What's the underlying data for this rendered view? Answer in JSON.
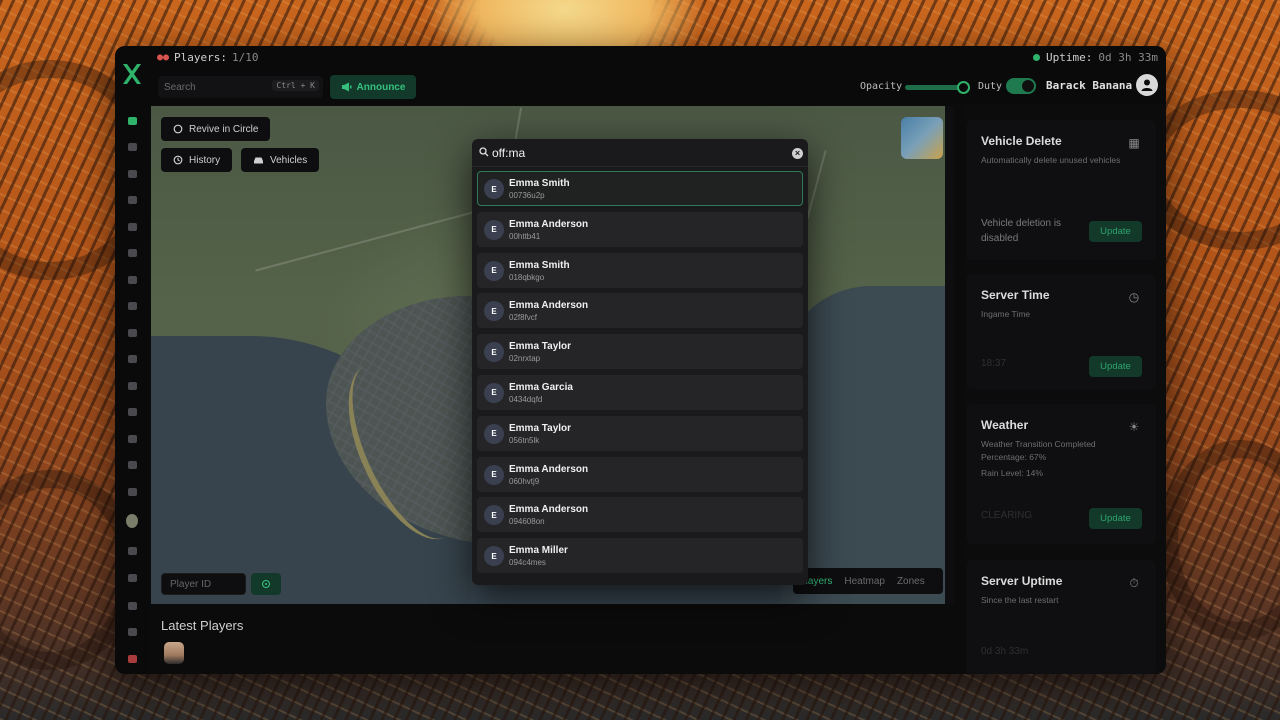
{
  "header": {
    "players_label": "Players:",
    "players_count": "1/10",
    "uptime_label": "Uptime:",
    "uptime_value": "0d 3h 33m",
    "search_placeholder": "Search",
    "search_shortcut": "Ctrl + K",
    "announce_label": "Announce",
    "opacity_label": "Opacity",
    "opacity_value": 0.95,
    "duty_label": "Duty",
    "duty_on": true,
    "username": "Barack Banana"
  },
  "sidebar": {
    "items": [
      "home-icon",
      "players-icon",
      "chat-icon",
      "grid-icon",
      "message-icon",
      "bug-icon",
      "car-icon",
      "inventory-icon",
      "calendar-icon",
      "shield-icon",
      "shield-alert-icon",
      "box-icon",
      "activity-icon",
      "server-icon",
      "clock-icon",
      "avatar",
      "layers-icon",
      "moon-icon",
      "help-icon",
      "settings-icon",
      "logout-icon"
    ]
  },
  "map": {
    "revive_label": "Revive in Circle",
    "history_label": "History",
    "vehicles_label": "Vehicles",
    "player_id_placeholder": "Player ID",
    "tabs": [
      "Players",
      "Heatmap",
      "Zones"
    ],
    "active_tab": "Players"
  },
  "latest_players": {
    "title": "Latest Players"
  },
  "cards": [
    {
      "title": "Vehicle Delete",
      "desc": "Automatically delete unused vehicles",
      "status": "Vehicle deletion is disabled",
      "button": "Update",
      "icon": "car-delete-icon"
    },
    {
      "title": "Server Time",
      "desc": "Ingame Time",
      "status": "18:37",
      "button": "Update",
      "icon": "clock-icon"
    },
    {
      "title": "Weather",
      "desc": "Weather Transition Completed Percentage: 67%",
      "desc2": "Rain Level: 14%",
      "status": "CLEARING",
      "button": "Update",
      "icon": "weather-icon"
    },
    {
      "title": "Server Uptime",
      "desc": "Since the last restart",
      "status": "0d 3h 33m",
      "icon": "uptime-icon"
    }
  ],
  "dropdown": {
    "query": "off:ma",
    "results": [
      {
        "initial": "E",
        "name": "Emma Smith",
        "id": "00736u2p"
      },
      {
        "initial": "E",
        "name": "Emma Anderson",
        "id": "00httb41"
      },
      {
        "initial": "E",
        "name": "Emma Smith",
        "id": "018qbkgo"
      },
      {
        "initial": "E",
        "name": "Emma Anderson",
        "id": "02f8fvcf"
      },
      {
        "initial": "E",
        "name": "Emma Taylor",
        "id": "02nrxtap"
      },
      {
        "initial": "E",
        "name": "Emma Garcia",
        "id": "0434dqfd"
      },
      {
        "initial": "E",
        "name": "Emma Taylor",
        "id": "056tn5lk"
      },
      {
        "initial": "E",
        "name": "Emma Anderson",
        "id": "060hvtj9"
      },
      {
        "initial": "E",
        "name": "Emma Anderson",
        "id": "094608on"
      },
      {
        "initial": "E",
        "name": "Emma Miller",
        "id": "094c4mes"
      }
    ]
  },
  "colors": {
    "accent": "#2fb36b",
    "accent_bg": "#12392a",
    "panel": "#0b0b0c",
    "danger": "#d9534f"
  }
}
